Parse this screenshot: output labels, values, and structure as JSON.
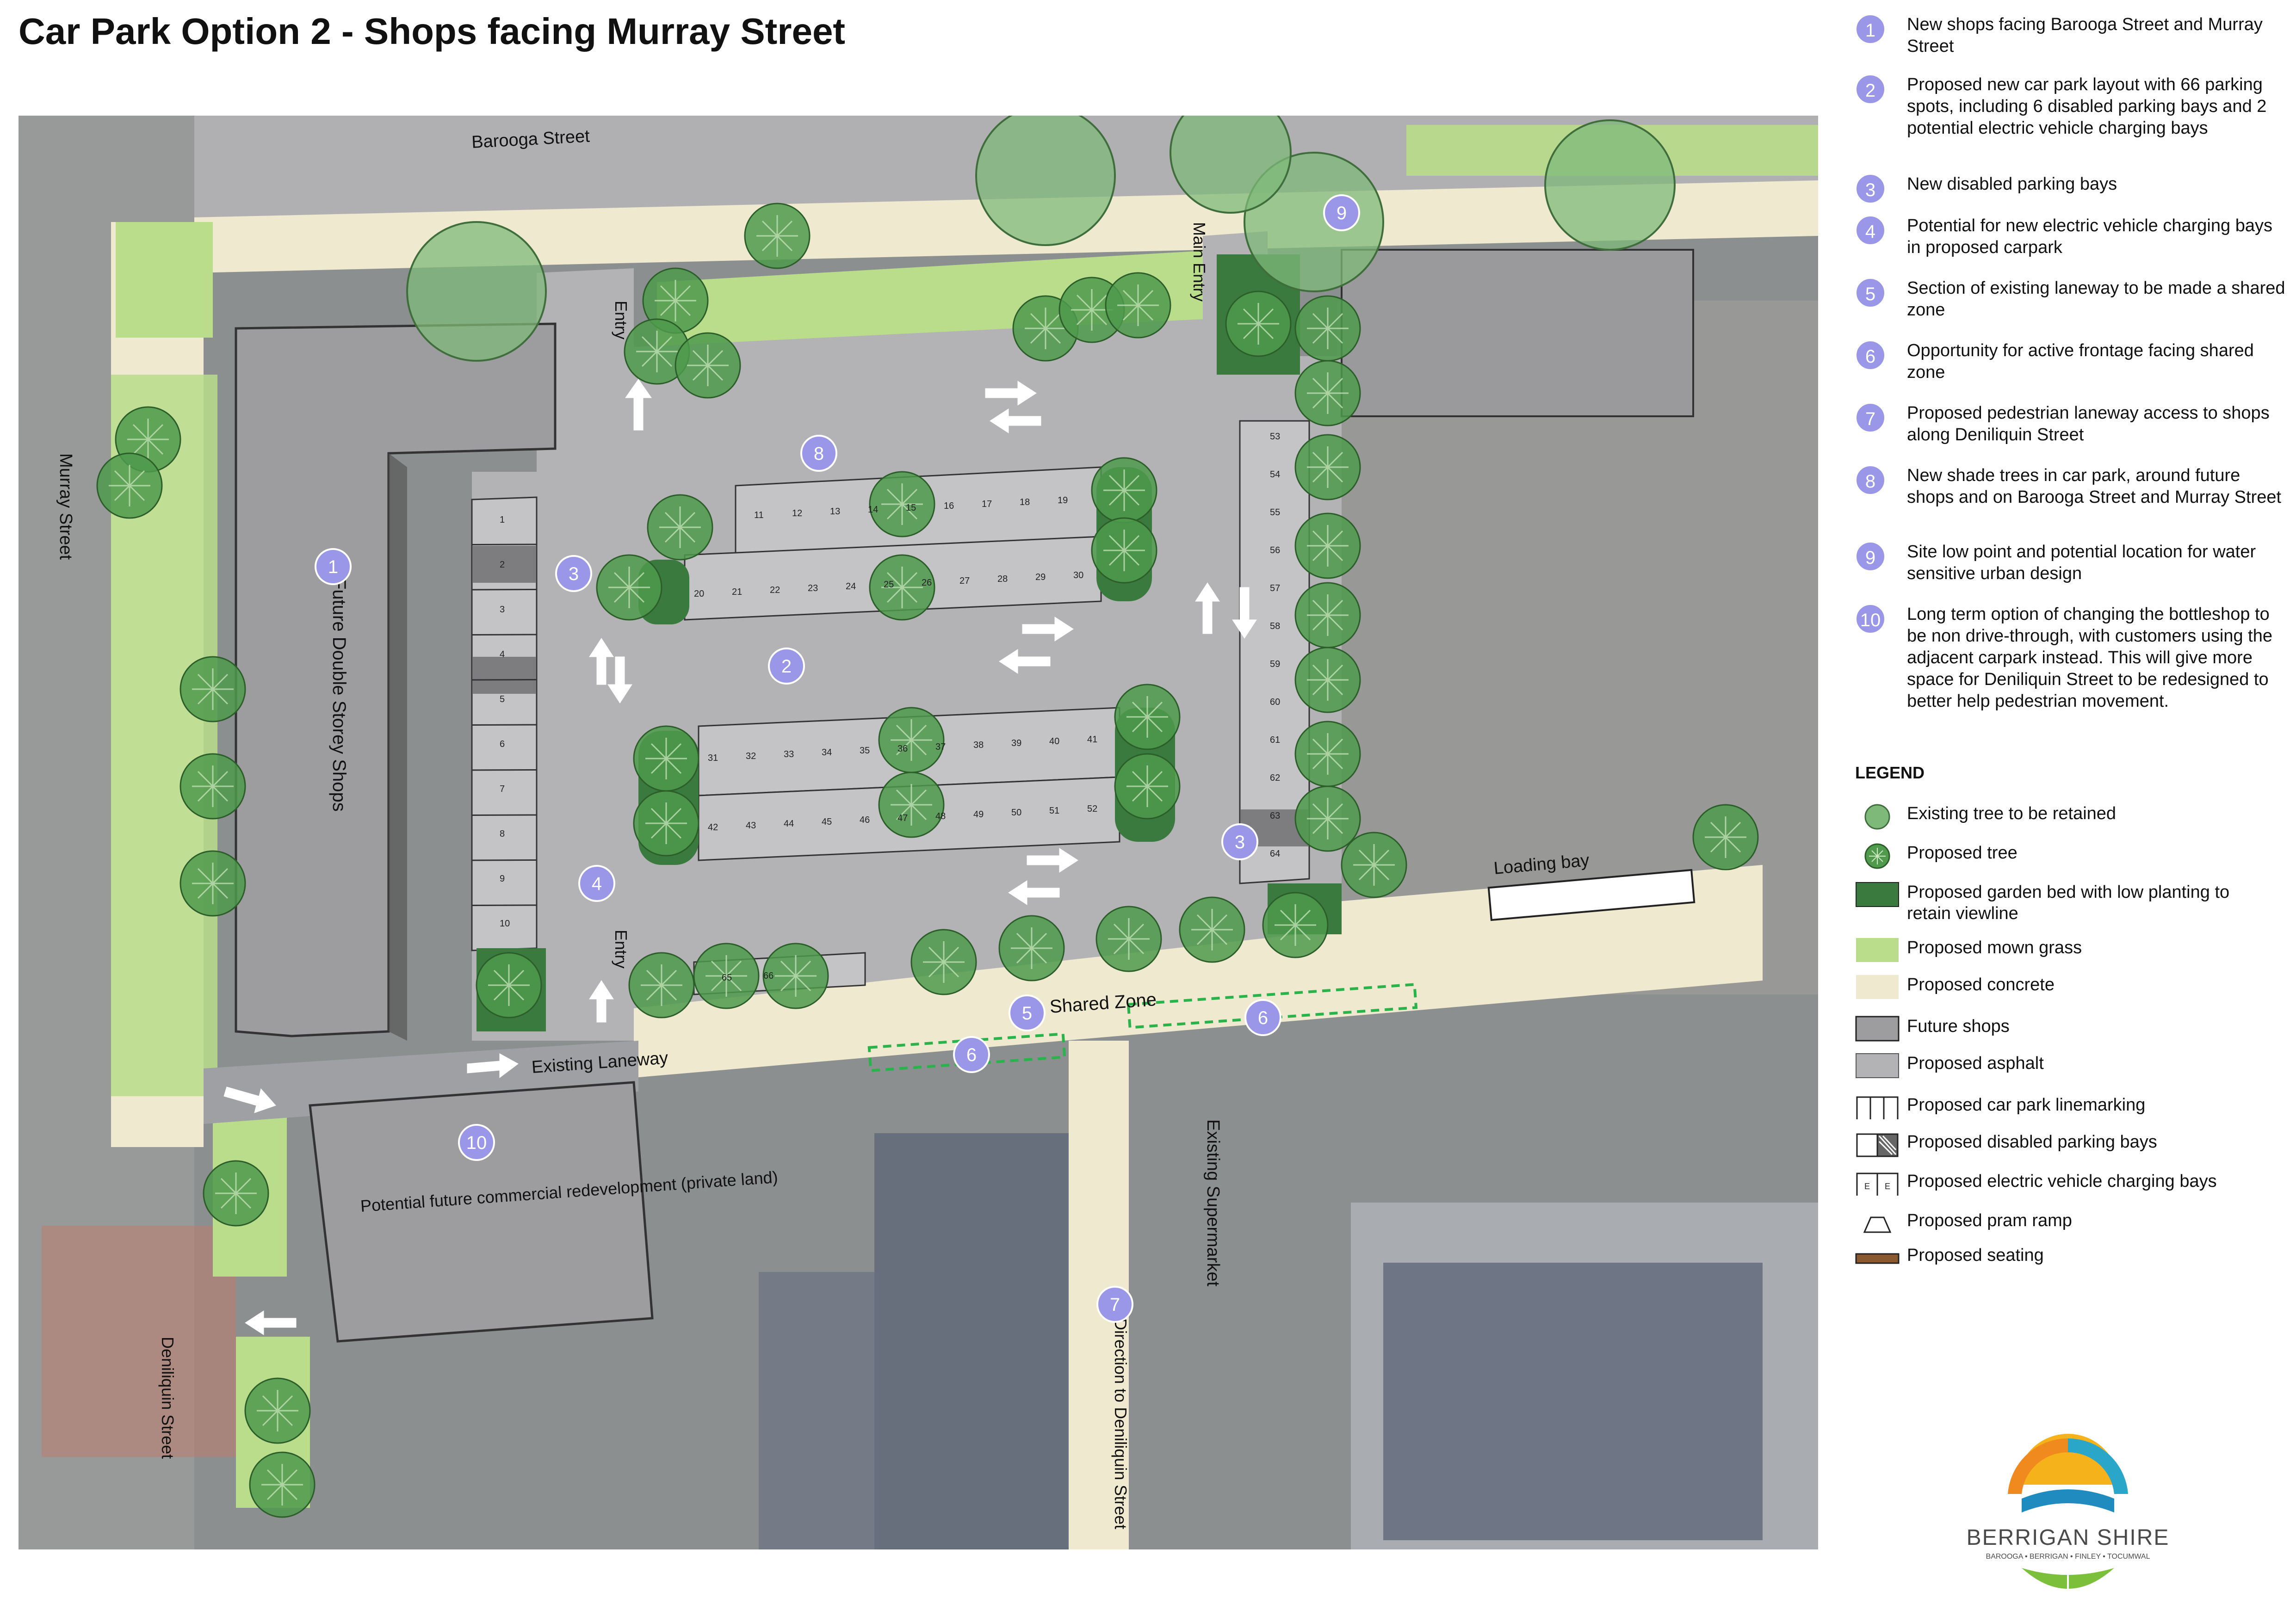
{
  "title": "Car Park Option 2 - Shops facing Murray Street",
  "colors": {
    "badge": "#9a97e8",
    "asphalt": "#b3b3b6",
    "shops": "#9d9da0",
    "concrete": "#efe9cf",
    "grass": "#b9dd8a",
    "garden": "#3a7a3e",
    "tree_existing": "#7fb97a",
    "tree_proposed": "#4f9a4c",
    "aerial": "#8c8f8f",
    "seating": "#8a5a2e"
  },
  "notes": [
    {
      "n": "1",
      "text": "New shops facing Barooga Street and Murray Street"
    },
    {
      "n": "2",
      "text": "Proposed new car park layout with 66 parking spots, including 6 disabled parking bays and 2 potential electric vehicle charging bays"
    },
    {
      "n": "3",
      "text": "New disabled parking bays"
    },
    {
      "n": "4",
      "text": "Potential for new electric vehicle charging bays in proposed carpark"
    },
    {
      "n": "5",
      "text": "Section of existing laneway to be made a shared zone"
    },
    {
      "n": "6",
      "text": "Opportunity for active frontage facing shared zone"
    },
    {
      "n": "7",
      "text": "Proposed pedestrian laneway access to shops along Deniliquin Street"
    },
    {
      "n": "8",
      "text": "New shade trees in car park, around future shops and on Barooga Street and Murray Street"
    },
    {
      "n": "9",
      "text": "Site low point and potential location for water sensitive urban design"
    },
    {
      "n": "10",
      "text": "Long term option of changing the bottleshop to be non drive-through, with customers using the adjacent carpark instead. This will give more space for Deniliquin Street to be redesigned to better help pedestrian movement."
    }
  ],
  "legend": {
    "heading": "LEGEND",
    "items": [
      {
        "label": "Existing tree to be retained",
        "symbol": "existing-tree-icon"
      },
      {
        "label": "Proposed tree",
        "symbol": "proposed-tree-icon"
      },
      {
        "label": "Proposed garden bed with low planting to retain viewline",
        "symbol": "garden-bed-swatch"
      },
      {
        "label": "Proposed mown grass",
        "symbol": "grass-swatch"
      },
      {
        "label": "Proposed concrete",
        "symbol": "concrete-swatch"
      },
      {
        "label": "Future shops",
        "symbol": "shops-swatch"
      },
      {
        "label": "Proposed asphalt",
        "symbol": "asphalt-swatch"
      },
      {
        "label": "Proposed car park linemarking",
        "symbol": "linemarking-icon"
      },
      {
        "label": "Proposed disabled parking bays",
        "symbol": "disabled-bay-icon"
      },
      {
        "label": "Proposed electric vehicle charging bays",
        "symbol": "ev-bay-icon"
      },
      {
        "label": "Proposed pram ramp",
        "symbol": "pram-ramp-icon"
      },
      {
        "label": "Proposed seating",
        "symbol": "seating-icon"
      }
    ]
  },
  "map_labels": {
    "barooga_street": "Barooga Street",
    "murray_street": "Murray Street",
    "future_shops": "Future Double Storey Shops",
    "entry": "Entry",
    "main_entry": "Main Entry",
    "loading_bay": "Loading bay",
    "shared_zone": "Shared Zone",
    "existing_laneway": "Existing Laneway",
    "potential_redevelopment": "Potential future commercial redevelopment (private land)",
    "existing_supermarket": "Existing Supermarket",
    "deniliquin_street": "Deniliquin Street",
    "direction_to": "Direction to Deniliquin Street"
  },
  "parking_numbers": {
    "left_column": [
      "1",
      "2",
      "3",
      "4",
      "5",
      "6",
      "7",
      "8",
      "9",
      "10"
    ],
    "row_a": [
      "11",
      "12",
      "13",
      "14",
      "15",
      "16",
      "17",
      "18",
      "19"
    ],
    "row_b": [
      "20",
      "21",
      "22",
      "23",
      "24",
      "25",
      "26",
      "27",
      "28",
      "29",
      "30"
    ],
    "row_c": [
      "31",
      "32",
      "33",
      "34",
      "35",
      "36",
      "37",
      "38",
      "39",
      "40",
      "41"
    ],
    "row_d": [
      "42",
      "43",
      "44",
      "45",
      "46",
      "47",
      "48",
      "49",
      "50",
      "51",
      "52"
    ],
    "right_column": [
      "53",
      "54",
      "55",
      "56",
      "57",
      "58",
      "59",
      "60",
      "61",
      "62",
      "63",
      "64"
    ],
    "bottom_row": [
      "65",
      "66"
    ]
  },
  "logo": {
    "name": "BERRIGAN SHIRE",
    "towns": "BAROOGA • BERRIGAN • FINLEY • TOCUMWAL"
  }
}
